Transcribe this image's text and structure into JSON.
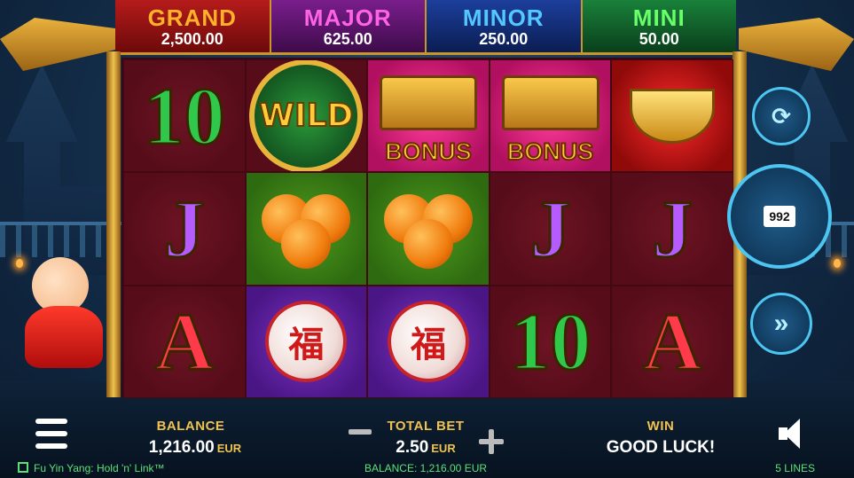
{
  "game": {
    "title": "Fu Yin Yang: Hold 'n' Link™"
  },
  "jackpots": [
    {
      "name": "GRAND",
      "value": "2,500.00"
    },
    {
      "name": "MAJOR",
      "value": "625.00"
    },
    {
      "name": "MINOR",
      "value": "250.00"
    },
    {
      "name": "MINI",
      "value": "50.00"
    }
  ],
  "reels": {
    "row1": [
      {
        "symbol": "10",
        "kind": "ten"
      },
      {
        "symbol": "WILD",
        "kind": "wild"
      },
      {
        "symbol": "BONUS",
        "kind": "bonus"
      },
      {
        "symbol": "BONUS",
        "kind": "bonus"
      },
      {
        "symbol": "gold-ingot",
        "kind": "ingot"
      }
    ],
    "row2": [
      {
        "symbol": "J",
        "kind": "j"
      },
      {
        "symbol": "oranges",
        "kind": "orange"
      },
      {
        "symbol": "oranges",
        "kind": "orange"
      },
      {
        "symbol": "J",
        "kind": "j"
      },
      {
        "symbol": "J",
        "kind": "j"
      }
    ],
    "row3": [
      {
        "symbol": "A",
        "kind": "a"
      },
      {
        "symbol": "lucky-pouch",
        "kind": "pouch"
      },
      {
        "symbol": "lucky-pouch",
        "kind": "pouch"
      },
      {
        "symbol": "10",
        "kind": "ten"
      },
      {
        "symbol": "A",
        "kind": "a"
      }
    ]
  },
  "controls": {
    "spin_counter": "992",
    "autoplay_icon": "autoplay-icon",
    "turbo_icon": "fast-forward-icon",
    "menu_icon": "hamburger-menu-icon",
    "sound_icon": "speaker-icon"
  },
  "bottom": {
    "balance_label": "BALANCE",
    "balance_value": "1,216.00",
    "balance_currency": "EUR",
    "bet_label": "TOTAL BET",
    "bet_value": "2.50",
    "bet_currency": "EUR",
    "win_label": "WIN",
    "win_value": "GOOD LUCK!"
  },
  "footer": {
    "balance_text": "BALANCE: 1,216.00 EUR",
    "lines_text": "5 LINES"
  },
  "colors": {
    "accent_gold": "#f0c24e",
    "footer_green": "#5de07a",
    "reel_bg": "#5d0f1c"
  }
}
